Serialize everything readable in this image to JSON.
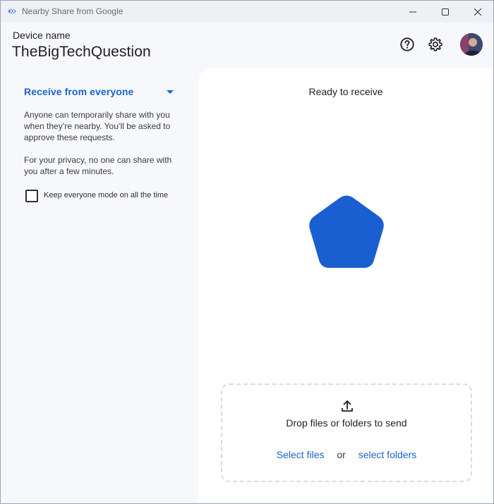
{
  "window": {
    "title": "Nearby Share from Google",
    "icon": "nearby-share-icon",
    "controls": [
      "minimize-icon",
      "maximize-icon",
      "close-icon"
    ]
  },
  "header": {
    "device_label": "Device name",
    "device_name": "TheBigTechQuestion",
    "icons": [
      "help-icon",
      "settings-icon"
    ],
    "avatar": "avatar"
  },
  "left_panel": {
    "receive_option": "Receive from everyone",
    "description_1": "Anyone can temporarily share with you when they’re nearby. You’ll be asked to approve these requests.",
    "description_2": "For your privacy, no one can share with you after a few minutes.",
    "checkbox_label": "Keep everyone mode on all the time",
    "checkbox_checked": false
  },
  "right_panel": {
    "status": "Ready to receive",
    "drop_text": "Drop files or folders to send",
    "select_files": "Select files",
    "or": "or",
    "select_folders": "select folders"
  },
  "colors": {
    "accent": "#1a64c8",
    "pentagon": "#1a5fd1",
    "background": "#f7f8fc",
    "panel": "#ffffff"
  }
}
